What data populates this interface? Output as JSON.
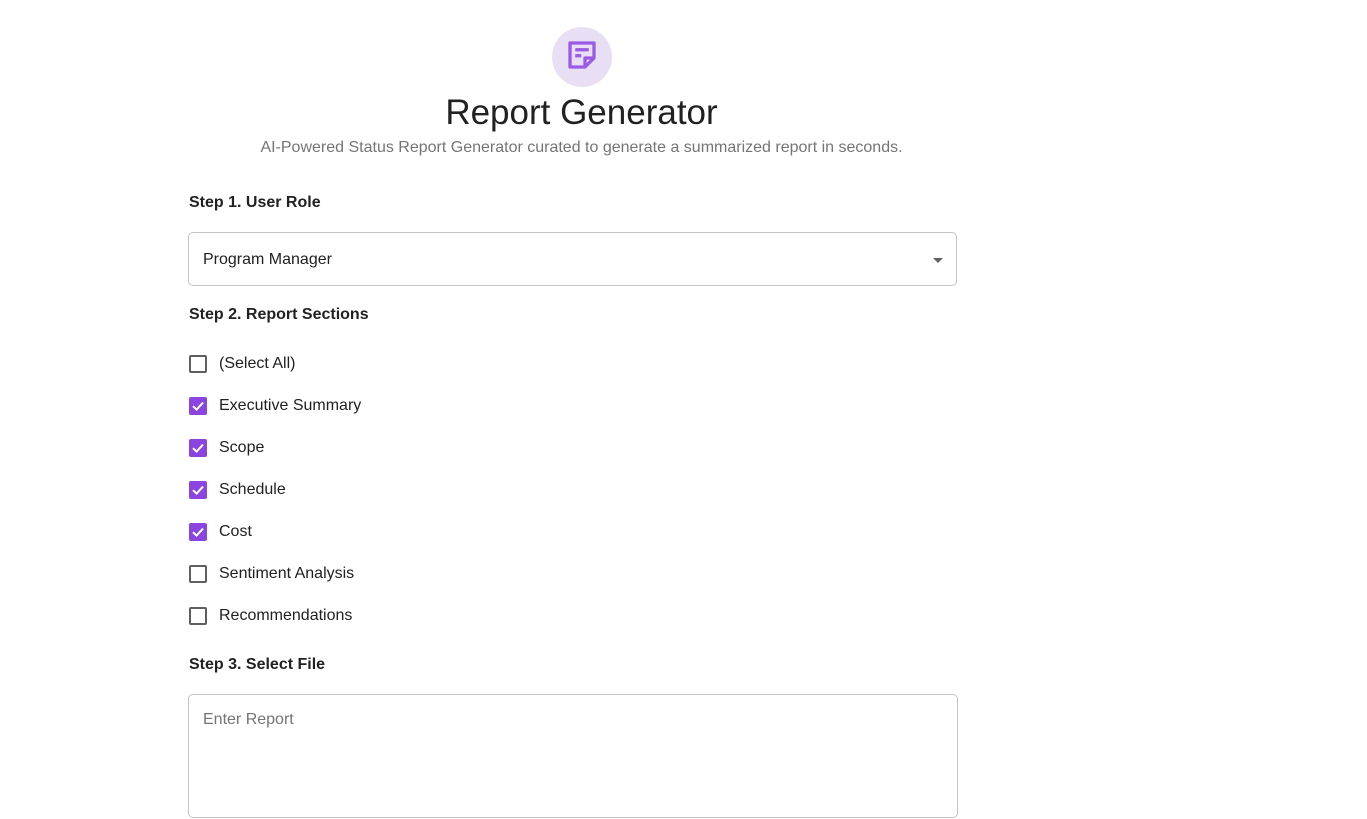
{
  "header": {
    "logo_icon": "report-note-icon",
    "title": "Report Generator",
    "subtitle": "AI-Powered Status Report Generator curated to generate a summarized report in seconds."
  },
  "step1": {
    "label": "Step 1. User Role",
    "selected_role": "Program Manager"
  },
  "step2": {
    "label": "Step 2. Report Sections",
    "options": [
      {
        "label": "(Select All)",
        "checked": false
      },
      {
        "label": "Executive Summary",
        "checked": true
      },
      {
        "label": "Scope",
        "checked": true
      },
      {
        "label": "Schedule",
        "checked": true
      },
      {
        "label": "Cost",
        "checked": true
      },
      {
        "label": "Sentiment Analysis",
        "checked": false
      },
      {
        "label": "Recommendations",
        "checked": false
      }
    ]
  },
  "step3": {
    "label": "Step 3. Select File",
    "placeholder": "Enter Report",
    "value": ""
  },
  "colors": {
    "accent": "#8a44e0",
    "logo_bg": "#e8dff5"
  }
}
